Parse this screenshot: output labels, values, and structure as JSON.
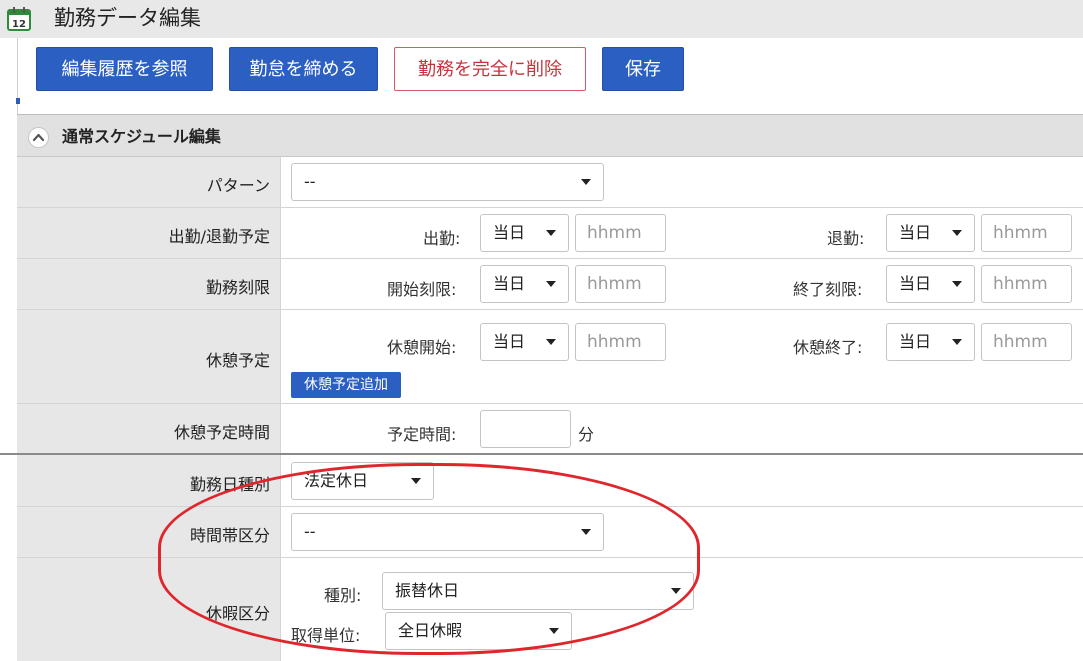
{
  "header": {
    "title": "勤務データ編集",
    "calendar_day": "12"
  },
  "toolbar": {
    "history_label": "編集履歴を参照",
    "close_label": "勤怠を締める",
    "delete_label": "勤務を完全に削除",
    "save_label": "保存"
  },
  "section": {
    "title": "通常スケジュール編集"
  },
  "form": {
    "pattern": {
      "label": "パターン",
      "value": "--"
    },
    "work_schedule": {
      "label": "出勤/退勤予定",
      "start_label": "出勤:",
      "start_day": "当日",
      "start_time_placeholder": "hhmm",
      "end_label": "退勤:",
      "end_day": "当日",
      "end_time_placeholder": "hhmm"
    },
    "work_limit": {
      "label": "勤務刻限",
      "start_label": "開始刻限:",
      "start_day": "当日",
      "start_time_placeholder": "hhmm",
      "end_label": "終了刻限:",
      "end_day": "当日",
      "end_time_placeholder": "hhmm"
    },
    "break_schedule": {
      "label": "休憩予定",
      "start_label": "休憩開始:",
      "start_day": "当日",
      "start_time_placeholder": "hhmm",
      "end_label": "休憩終了:",
      "end_day": "当日",
      "end_time_placeholder": "hhmm",
      "add_button": "休憩予定追加"
    },
    "break_duration": {
      "label": "休憩予定時間",
      "field_label": "予定時間:",
      "value": "",
      "unit": "分"
    },
    "day_type": {
      "label": "勤務日種別",
      "value": "法定休日"
    },
    "time_zone": {
      "label": "時間帯区分",
      "value": "--"
    },
    "leave": {
      "label": "休暇区分",
      "type_label": "種別:",
      "type_value": "振替休日",
      "unit_label": "取得単位:",
      "unit_value": "全日休暇"
    }
  },
  "colors": {
    "primary": "#2b5fc2",
    "danger": "#c8323c",
    "highlight": "#e0262d"
  }
}
